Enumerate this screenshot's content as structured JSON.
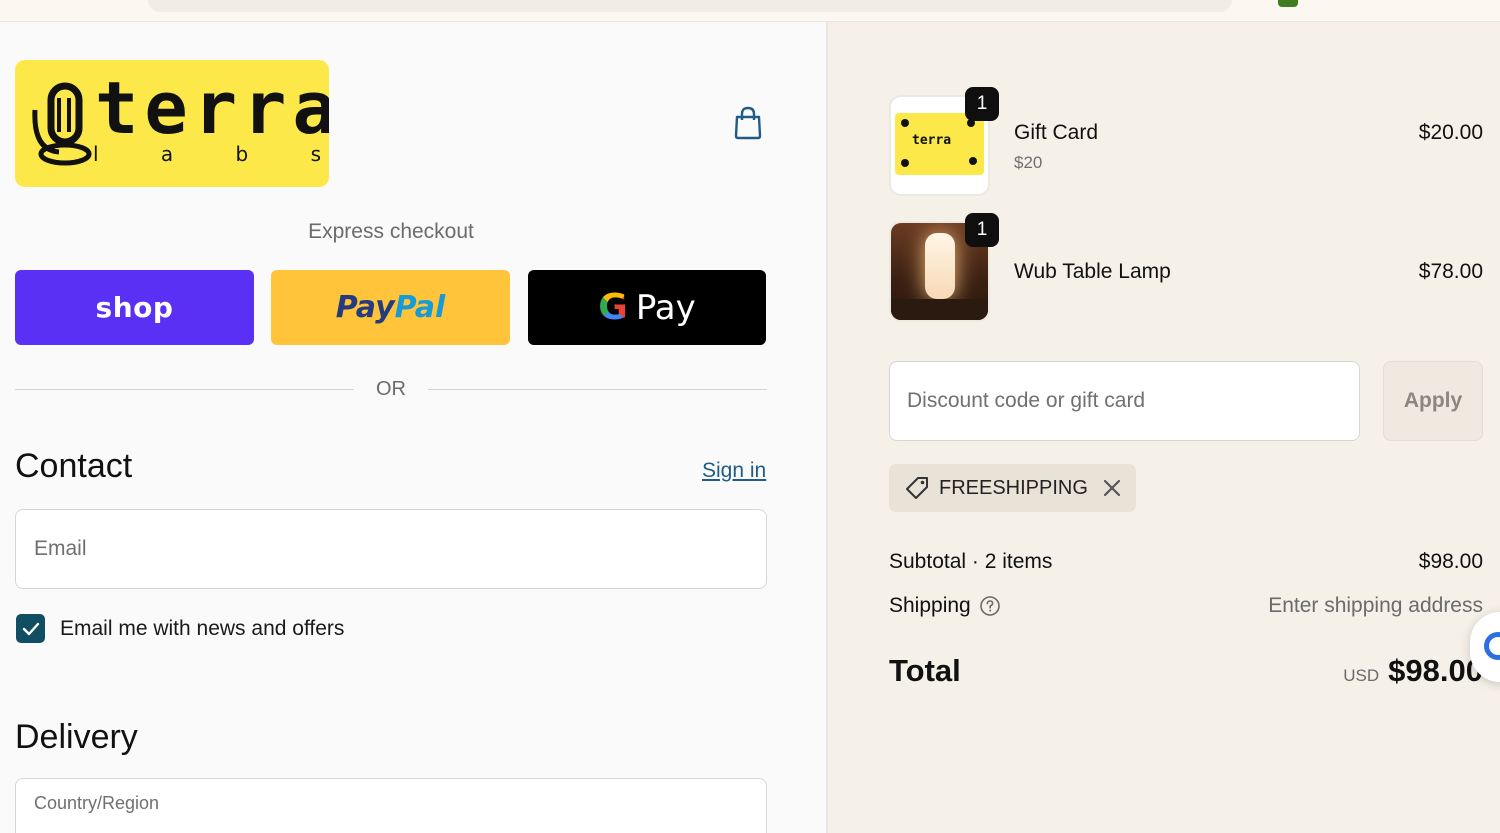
{
  "brand": {
    "logo_word": "terra",
    "logo_sub": [
      "l",
      "a",
      "b",
      "s"
    ]
  },
  "express": {
    "label": "Express checkout",
    "shop_label": "shop",
    "paypal_part1": "Pay",
    "paypal_part2": "Pal",
    "gpay_g": "G",
    "gpay_label": "Pay"
  },
  "divider": {
    "or_label": "OR"
  },
  "contact": {
    "title": "Contact",
    "signin_label": "Sign in",
    "email_placeholder": "Email",
    "newsletter_label": "Email me with news and offers",
    "newsletter_checked": true
  },
  "delivery": {
    "title": "Delivery",
    "country_placeholder": "Country/Region"
  },
  "cart": {
    "items": [
      {
        "name": "Gift Card",
        "variant": "$20",
        "quantity": "1",
        "price": "$20.00",
        "thumb_text": "terra"
      },
      {
        "name": "Wub Table Lamp",
        "variant": "",
        "quantity": "1",
        "price": "$78.00"
      }
    ]
  },
  "discount": {
    "placeholder": "Discount code or gift card",
    "apply_label": "Apply",
    "applied_code": "FREESHIPPING"
  },
  "summary": {
    "subtotal_label": "Subtotal · 2 items",
    "subtotal_value": "$98.00",
    "shipping_label": "Shipping",
    "shipping_value": "Enter shipping address",
    "total_label": "Total",
    "total_currency": "USD",
    "total_value": "$98.00"
  },
  "colors": {
    "shop_purple": "#5a31f4",
    "paypal_yellow": "#ffc439",
    "logo_yellow": "#fde84a",
    "checkbox_teal": "#124e63",
    "link_blue": "#1f5d86",
    "summary_bg": "#f5f0e8"
  }
}
